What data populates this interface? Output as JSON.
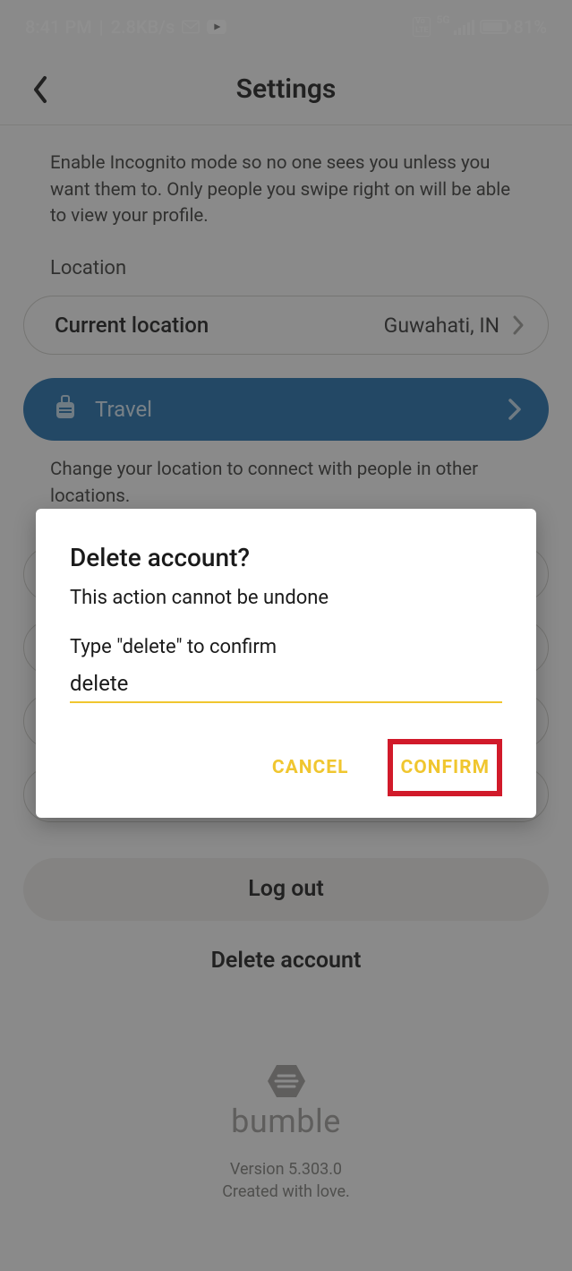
{
  "status": {
    "time": "8:41 PM",
    "speed": "2.8KB/s",
    "net_badge": "Vo\nLTE",
    "net_type": "5G",
    "battery_pct": "81%"
  },
  "header": {
    "title": "Settings"
  },
  "incognito_help": "Enable Incognito mode so no one sees you unless you want them to. Only people you swipe right on will be able to view your profile.",
  "location": {
    "section_label": "Location",
    "current_label": "Current location",
    "current_value": "Guwahati, IN",
    "travel_label": "Travel",
    "travel_help": "Change your location to connect with people in other locations."
  },
  "actions": {
    "logout": "Log out",
    "delete_account": "Delete account"
  },
  "footer": {
    "brand": "bumble",
    "version": "Version 5.303.0",
    "tagline": "Created with love."
  },
  "dialog": {
    "title": "Delete account?",
    "subtitle": "This action cannot be undone",
    "instruction": "Type \"delete\" to confirm",
    "input_value": "delete",
    "cancel": "CANCEL",
    "confirm": "CONFIRM"
  }
}
